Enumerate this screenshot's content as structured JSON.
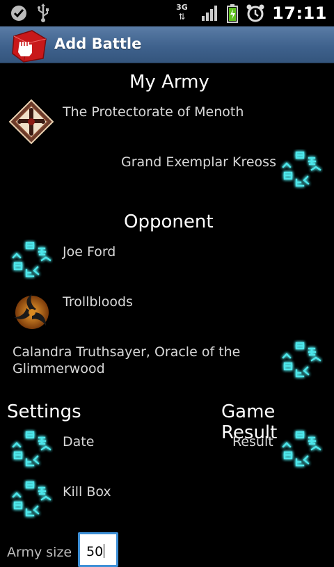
{
  "status_bar": {
    "time": "17:11",
    "network": "3G",
    "icons": [
      "check-circle-icon",
      "usb-icon",
      "signal-icon",
      "battery-charging-icon",
      "alarm-icon"
    ]
  },
  "title_bar": {
    "title": "Add Battle",
    "icon": "red-fist-dice-icon"
  },
  "my_army": {
    "heading": "My Army",
    "faction": "The Protectorate of Menoth",
    "faction_icon": "menoth-cross-icon",
    "warcaster": "Grand Exemplar Kreoss",
    "warcaster_icon": "glyph-ring-icon"
  },
  "opponent": {
    "heading": "Opponent",
    "player": "Joe Ford",
    "faction": "Trollbloods",
    "faction_icon": "trollbloods-icon",
    "warcaster": "Calandra Truthsayer, Oracle of the Glimmerwood"
  },
  "settings": {
    "heading": "Settings",
    "date_label": "Date",
    "scenario_label": "Kill Box",
    "army_size_label": "Army size",
    "army_size_value": "50"
  },
  "game_result": {
    "heading": "Game Result",
    "result_label": "Result"
  },
  "colors": {
    "title_bar": "#3f628d",
    "glyph": "#4ee6ea",
    "input_border": "#3d8fd6"
  }
}
